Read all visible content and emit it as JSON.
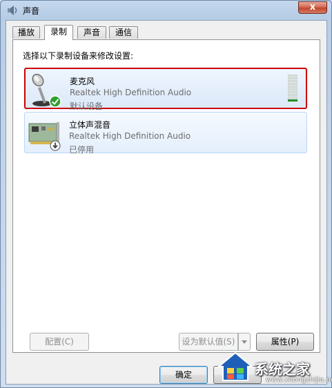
{
  "window": {
    "title": "声音",
    "close_label": "x"
  },
  "tabs": [
    {
      "label": "播放",
      "active": false
    },
    {
      "label": "录制",
      "active": true
    },
    {
      "label": "声音",
      "active": false
    },
    {
      "label": "通信",
      "active": false
    }
  ],
  "panel": {
    "instruction": "选择以下录制设备来修改设置:"
  },
  "devices": [
    {
      "name": "麦克风",
      "description": "Realtek High Definition Audio",
      "status": "默认设备",
      "icon": "microphone-icon",
      "status_icon": "green-check-icon",
      "selected": true,
      "level_segments_total": 10,
      "level_segments_on": 1
    },
    {
      "name": "立体声混音",
      "description": "Realtek High Definition Audio",
      "status": "已停用",
      "icon": "sound-card-icon",
      "status_icon": "disabled-arrow-icon",
      "selected": false
    }
  ],
  "buttons": {
    "configure": "配置(C)",
    "set_default": "设为默认值(S)",
    "properties": "属性(P)",
    "ok": "确定",
    "cancel": ""
  },
  "watermark": {
    "text": "系统之家",
    "url": "www.xitongzhijia.net"
  },
  "colors": {
    "selected_border": "#cc0000",
    "level_on": "#2aa42a",
    "default_check": "#2ea02e"
  }
}
